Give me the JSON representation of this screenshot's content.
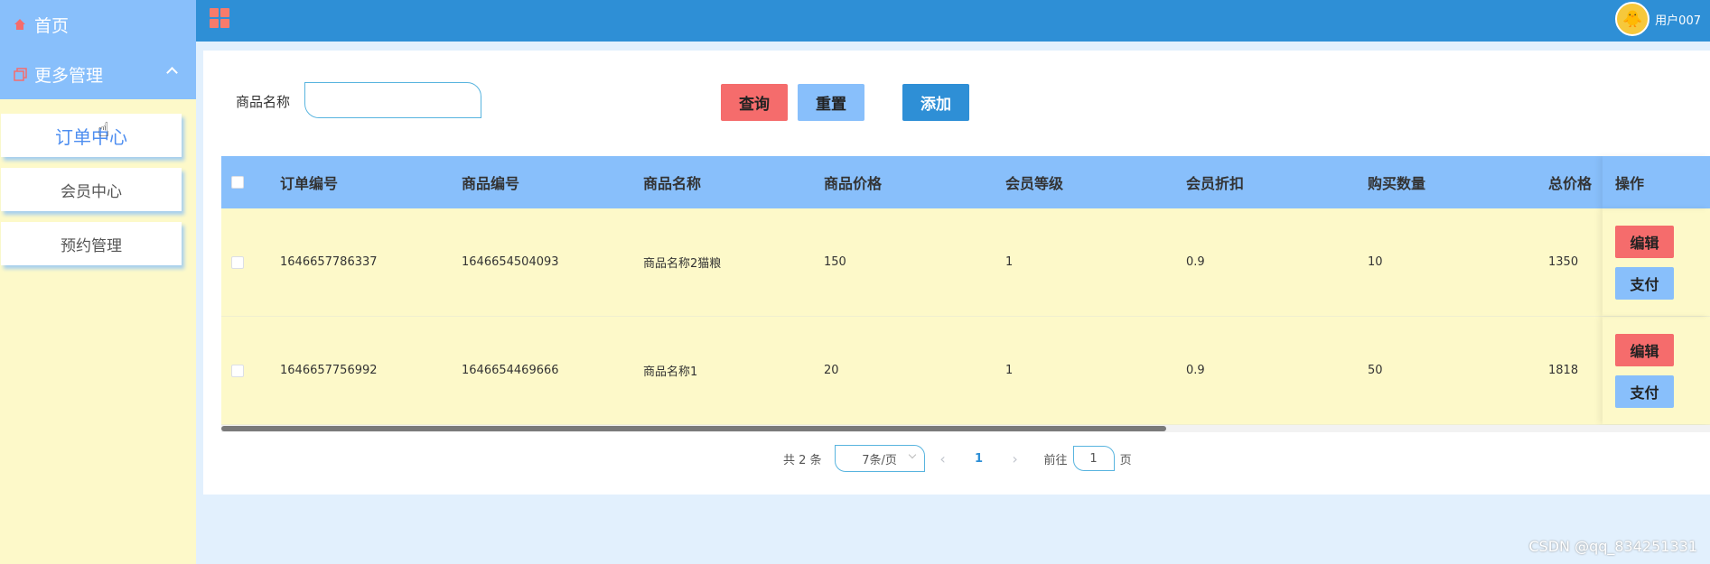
{
  "sidebar": {
    "home_label": "首页",
    "more_label": "更多管理",
    "items": [
      {
        "label": "订单中心"
      },
      {
        "label": "会员中心"
      },
      {
        "label": "预约管理"
      }
    ]
  },
  "header": {
    "username": "用户007"
  },
  "search": {
    "label": "商品名称",
    "value": "",
    "search_button": "查询",
    "reset_button": "重置",
    "add_button": "添加"
  },
  "table": {
    "columns": [
      "订单编号",
      "商品编号",
      "商品名称",
      "商品价格",
      "会员等级",
      "会员折扣",
      "购买数量",
      "总价格",
      "操作"
    ],
    "rows": [
      {
        "order_no": "1646657786337",
        "goods_no": "1646654504093",
        "goods_name": "商品名称2猫粮",
        "price": "150",
        "level": "1",
        "discount": "0.9",
        "quantity": "10",
        "total": "1350",
        "edit": "编辑",
        "pay": "支付"
      },
      {
        "order_no": "1646657756992",
        "goods_no": "1646654469666",
        "goods_name": "商品名称1",
        "price": "20",
        "level": "1",
        "discount": "0.9",
        "quantity": "50",
        "total": "1818",
        "edit": "编辑",
        "pay": "支付"
      }
    ]
  },
  "pagination": {
    "total_text": "共 2 条",
    "page_size": "7条/页",
    "current_page": "1",
    "goto_label": "前往",
    "goto_value": "1",
    "page_suffix": "页"
  },
  "watermark": "CSDN @qq_834251331",
  "colors": {
    "header": "#2e8fd6",
    "accent_blue": "#88bffb",
    "danger": "#f56c6c",
    "row_bg": "#fdf9c9"
  }
}
